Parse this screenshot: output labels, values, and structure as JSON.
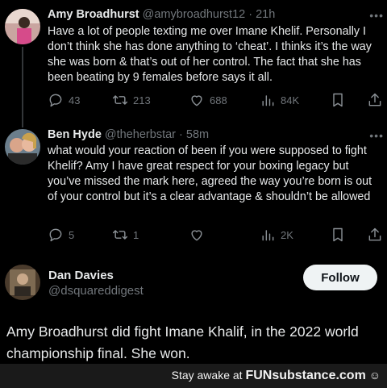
{
  "tweets": [
    {
      "name": "Amy Broadhurst",
      "handle": "@amybroadhurst12",
      "time": "21h",
      "text": "Have a lot of people texting me over Imane Khelif. Personally I don’t think she has done anything to ‘cheat’. I thinks it’s the way she was born & that’s out of her control. The fact that she has been beating by 9 females before says it all.",
      "replies": "43",
      "reposts": "213",
      "likes": "688",
      "views": "84K"
    },
    {
      "name": "Ben Hyde",
      "handle": "@theherbstar",
      "time": "58m",
      "text": "what would your reaction of been if you were supposed to fight Khelif? Amy I have great respect for your boxing legacy but you’ve missed the mark here, agreed the way you’re born is out of your control but it’s a clear advantage & shouldn’t be allowed",
      "replies": "5",
      "reposts": "1",
      "likes": "",
      "views": "2K"
    }
  ],
  "poster": {
    "name": "Dan Davies",
    "handle": "@dsquareddigest",
    "follow_label": "Follow",
    "text": "Amy Broadhurst  did fight Imane Khalif, in the 2022 world championship final. She won."
  },
  "footer": {
    "prefix": "Stay awake at ",
    "brand": "FUNsubstance.com",
    "badge": "☺"
  },
  "icons": [
    "reply-icon",
    "repost-icon",
    "like-icon",
    "views-icon",
    "bookmark-icon",
    "share-icon",
    "more-icon"
  ],
  "colors": {
    "background": "#000000",
    "text": "#e7e9ea",
    "muted": "#71767b",
    "follow_bg": "#eff3f4"
  }
}
